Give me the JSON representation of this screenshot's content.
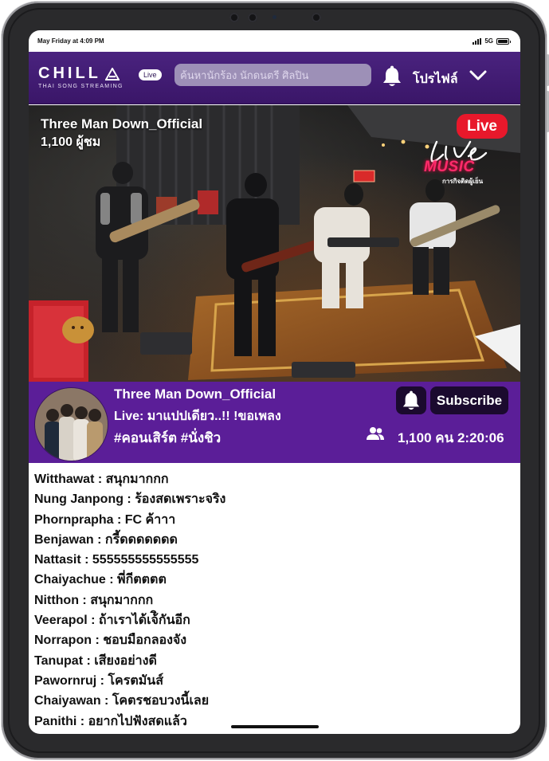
{
  "status_bar": {
    "time": "May Friday at 4:09 PM",
    "network": "5G"
  },
  "header": {
    "brand_name": "CHILL",
    "brand_tagline": "THAI SONG STREAMING",
    "live_label": "Live",
    "search_placeholder": "ค้นหานักร้อง นักดนตรี ศิลปิน",
    "profile_label": "โปรไฟล์"
  },
  "video": {
    "channel": "Three Man Down_Official",
    "viewers": "1,100 ผู้ชม",
    "live_badge": "Live",
    "overlay_logo_word": "MUSIC",
    "overlay_logo_tag": "การกิจติดผู้เย็น"
  },
  "stream_info": {
    "channel": "Three Man Down_Official",
    "title": "Live: มาแปปเดียว..!! !ขอเพลง",
    "tags": "#คอนเสิร์ต #นั่งชิว",
    "subscribe_label": "Subscribe",
    "stats": "1,100 คน 2:20:06"
  },
  "chat": [
    {
      "user": "Witthawat",
      "message": "สนุกมากกก"
    },
    {
      "user": "Nung Janpong",
      "message": "ร้องสดเพราะจริง"
    },
    {
      "user": "Phornprapha",
      "message": "FC ค้าาา"
    },
    {
      "user": "Benjawan",
      "message": "กรี้ดดดดดดด"
    },
    {
      "user": "Nattasit",
      "message": "555555555555555"
    },
    {
      "user": "Chaiyachue",
      "message": "พี่กีตตตต"
    },
    {
      "user": "Nitthon",
      "message": "สนุกมากกก"
    },
    {
      "user": "Veerapol",
      "message": "ถ้าเราได้เจ้ิกันอีก"
    },
    {
      "user": "Norrapon",
      "message": "ชอบมือกลองจัง"
    },
    {
      "user": "Tanupat",
      "message": "เสียงอย่างดี"
    },
    {
      "user": "Pawornruj",
      "message": "โครตมันส์"
    },
    {
      "user": "Chaiyawan",
      "message": "โคตรชอบวงนี้เลย"
    },
    {
      "user": "Panithi",
      "message": "อยากไปฟังสดแล้ว"
    }
  ],
  "colors": {
    "header_bg": "#4a237f",
    "panel_bg": "#5b1e98",
    "live_red": "#e8182b",
    "button_dark": "#1b0a2e"
  }
}
